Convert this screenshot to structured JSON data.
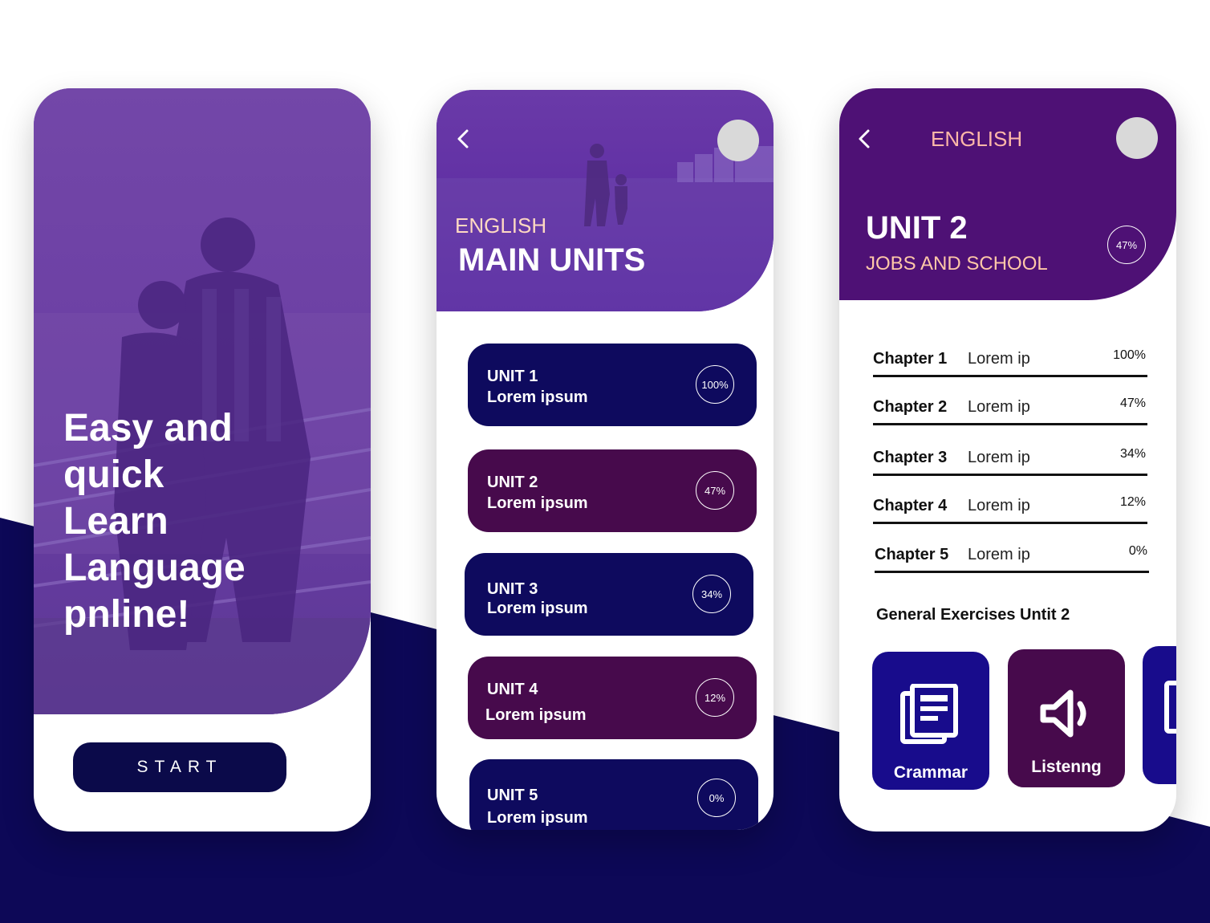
{
  "colors": {
    "page_navy": "#0d0857",
    "hero_purple": "#6e44a6",
    "unit_navy": "#0e0a5e",
    "unit_plum": "#470a4c",
    "header_purple": "#4e1175",
    "accent_peach": "#ffc8a8",
    "exercise_indigo": "#180c8c"
  },
  "screen1": {
    "headline": [
      "Easy and",
      "quick",
      "Learn",
      "Language",
      "pnline!"
    ],
    "start_label": "START"
  },
  "screen2": {
    "back_icon": "chevron-left-icon",
    "language": "ENGLISH",
    "title": "MAIN UNITS",
    "units": [
      {
        "title": "UNIT 1",
        "subtitle": "Lorem ipsum",
        "progress": "100%",
        "color": "navy"
      },
      {
        "title": "UNIT 2",
        "subtitle": "Lorem ipsum",
        "progress": "47%",
        "color": "plum"
      },
      {
        "title": "UNIT 3",
        "subtitle": "Lorem ipsum",
        "progress": "34%",
        "color": "navy"
      },
      {
        "title": "UNIT 4",
        "subtitle": "Lorem ipsum",
        "progress": "12%",
        "color": "plum"
      },
      {
        "title": "UNIT 5",
        "subtitle": "Lorem ipsum",
        "progress": "0%",
        "color": "navy"
      }
    ]
  },
  "screen3": {
    "back_icon": "chevron-left-icon",
    "language": "ENGLISH",
    "unit": "UNIT 2",
    "unit_subtitle": "JOBS AND SCHOOL",
    "unit_progress": "47%",
    "chapters": [
      {
        "name": "Chapter 1",
        "desc": "Lorem ip",
        "progress": "100%"
      },
      {
        "name": "Chapter 2",
        "desc": "Lorem ip",
        "progress": "47%"
      },
      {
        "name": "Chapter 3",
        "desc": "Lorem ip",
        "progress": "34%"
      },
      {
        "name": "Chapter 4",
        "desc": "Lorem ip",
        "progress": "12%"
      },
      {
        "name": "Chapter 5",
        "desc": "Lorem ip",
        "progress": "0%"
      }
    ],
    "section_title": "General Exercises Untit 2",
    "exercises": [
      {
        "label": "Crammar",
        "icon": "document-icon"
      },
      {
        "label": "Listenng",
        "icon": "speaker-icon"
      }
    ]
  }
}
